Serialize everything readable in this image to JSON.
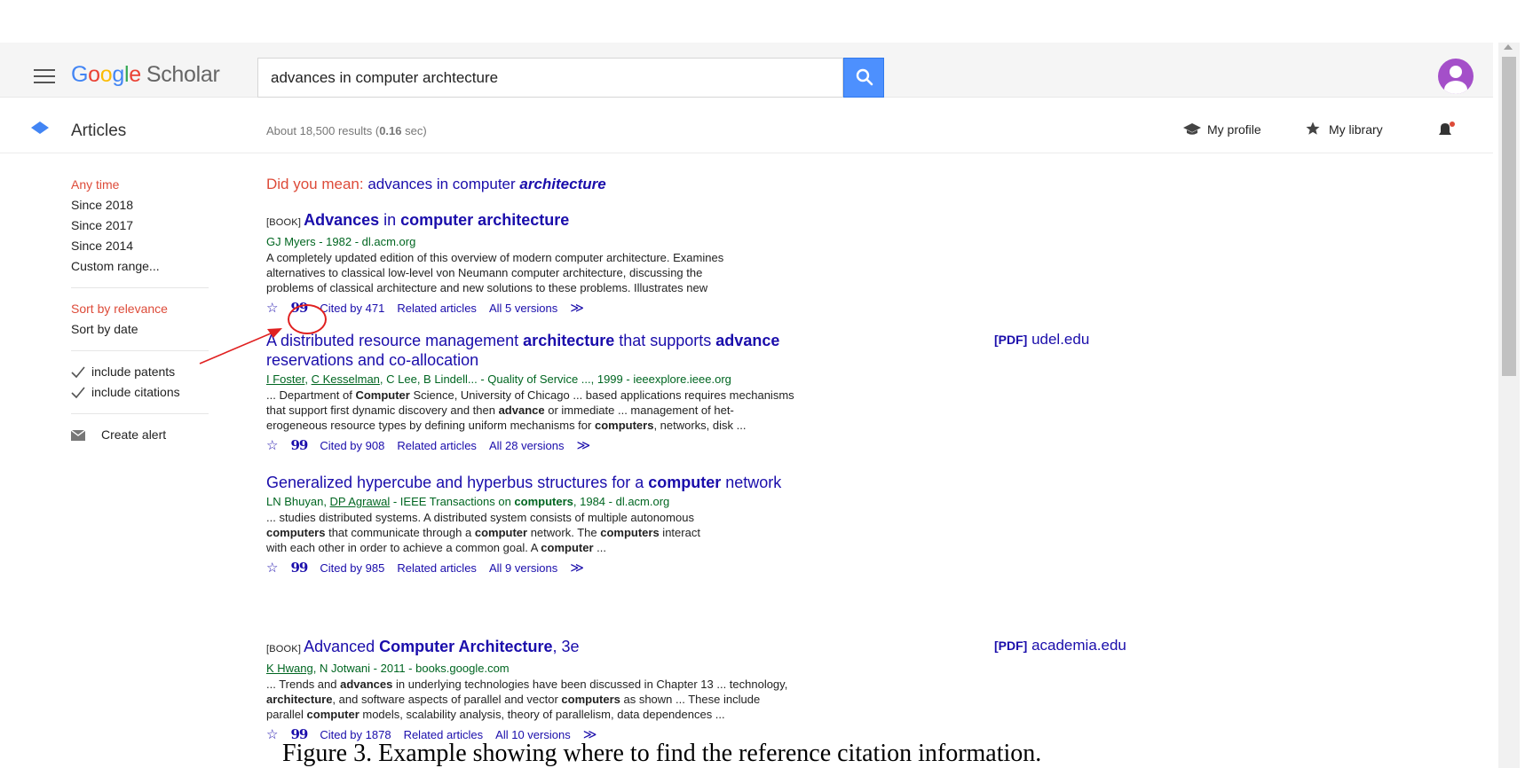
{
  "header": {
    "logo_parts": [
      "G",
      "o",
      "o",
      "g",
      "l",
      "e"
    ],
    "logo_suffix": "Scholar",
    "search_value": "advances in computer archtecture",
    "search_icon": "search-icon",
    "avatar_icon": "user-avatar-icon"
  },
  "subbar": {
    "section_label": "Articles",
    "results_prefix": "About 18,500 results (",
    "results_time": "0.16",
    "results_suffix": " sec)",
    "my_profile": "My profile",
    "my_library": "My library"
  },
  "filters": {
    "time": [
      "Any time",
      "Since 2018",
      "Since 2017",
      "Since 2014",
      "Custom range..."
    ],
    "sort": [
      "Sort by relevance",
      "Sort by date"
    ],
    "checks": [
      "include patents",
      "include citations"
    ],
    "create_alert": "Create alert"
  },
  "did_you_mean": {
    "prefix": "Did you mean: ",
    "plain": "advances in computer ",
    "emph": "architecture"
  },
  "results": [
    {
      "tag": "[BOOK]",
      "title_parts": [
        [
          "Advances",
          true
        ],
        [
          " in ",
          false
        ],
        [
          "computer architecture",
          true
        ]
      ],
      "meta": "GJ Myers - 1982 - dl.acm.org",
      "snippet": [
        "A completely updated edition of this overview of modern computer architecture. Examines",
        "alternatives to classical low-level von Neumann computer architecture, discussing the",
        "problems of classical architecture and new solutions to these problems. Illustrates new"
      ],
      "cited_by": "Cited by 471",
      "related": "Related articles",
      "versions": "All 5 versions"
    },
    {
      "tag": "",
      "title_line1": [
        [
          "A distributed resource management ",
          false
        ],
        [
          "architecture",
          true
        ],
        [
          " that supports ",
          false
        ],
        [
          "advance",
          true
        ]
      ],
      "title_line2": "reservations and co-allocation",
      "meta_authors": [
        "I Foster",
        "C Kesselman"
      ],
      "meta_rest": ", C Lee, B Lindell... - Quality of Service ..., 1999 - ieeexplore.ieee.org",
      "snippet_lines": [
        [
          [
            "... Department of ",
            false
          ],
          [
            "Computer",
            true
          ],
          [
            " Science, University of Chicago ... based applications requires mechanisms",
            false
          ]
        ],
        [
          [
            "that support first dynamic discovery and then ",
            false
          ],
          [
            "advance",
            true
          ],
          [
            " or immediate ... management of het-",
            false
          ]
        ],
        [
          [
            "erogeneous resource types by defining uniform mechanisms for ",
            false
          ],
          [
            "computers",
            true
          ],
          [
            ", networks, disk ...",
            false
          ]
        ]
      ],
      "cited_by": "Cited by 908",
      "related": "Related articles",
      "versions": "All 28 versions",
      "pdf_tag": "[PDF]",
      "pdf_source": "udel.edu"
    },
    {
      "tag": "",
      "title_parts": [
        [
          "Generalized hypercube and hyperbus structures for a ",
          false
        ],
        [
          "computer",
          true
        ],
        [
          " network",
          false
        ]
      ],
      "meta_plain1": "LN Bhuyan, ",
      "meta_author": "DP Agrawal",
      "meta_plain2": " - IEEE Transactions on ",
      "meta_bold": "computers",
      "meta_plain3": ", 1984 - dl.acm.org",
      "snippet_lines": [
        [
          [
            "... studies distributed systems. A distributed system consists of multiple autonomous",
            false
          ]
        ],
        [
          [
            "computers",
            true
          ],
          [
            " that communicate through a ",
            false
          ],
          [
            "computer",
            true
          ],
          [
            " network. The ",
            false
          ],
          [
            "computers",
            true
          ],
          [
            " interact",
            false
          ]
        ],
        [
          [
            "with each other in order to achieve a common goal. A ",
            false
          ],
          [
            "computer",
            true
          ],
          [
            " ...",
            false
          ]
        ]
      ],
      "cited_by": "Cited by 985",
      "related": "Related articles",
      "versions": "All 9 versions"
    },
    {
      "tag": "[BOOK]",
      "title_parts": [
        [
          "Advanced ",
          false
        ],
        [
          "Computer Architecture",
          true
        ],
        [
          ", 3e",
          false
        ]
      ],
      "meta_author": "K Hwang",
      "meta_rest": ", N Jotwani - 2011 - books.google.com",
      "snippet_lines": [
        [
          [
            "... Trends and ",
            false
          ],
          [
            "advances",
            true
          ],
          [
            " in underlying technologies have been discussed in Chapter 13 ... technology,",
            false
          ]
        ],
        [
          [
            "architecture",
            true
          ],
          [
            ", and software aspects of parallel and vector ",
            false
          ],
          [
            "computers",
            true
          ],
          [
            " as shown ... These include",
            false
          ]
        ],
        [
          [
            "parallel ",
            false
          ],
          [
            "computer",
            true
          ],
          [
            " models, scalability analysis, theory of parallelism, data dependences ...",
            false
          ]
        ]
      ],
      "cited_by": "Cited by 1878",
      "related": "Related articles",
      "versions": "All 10 versions",
      "pdf_tag": "[PDF]",
      "pdf_source": "academia.edu"
    }
  ],
  "icons": {
    "star": "☆",
    "quote": "99",
    "more": "≫"
  },
  "annotation_color": "#e02020",
  "caption": "Figure 3. Example showing where to find the reference citation information."
}
